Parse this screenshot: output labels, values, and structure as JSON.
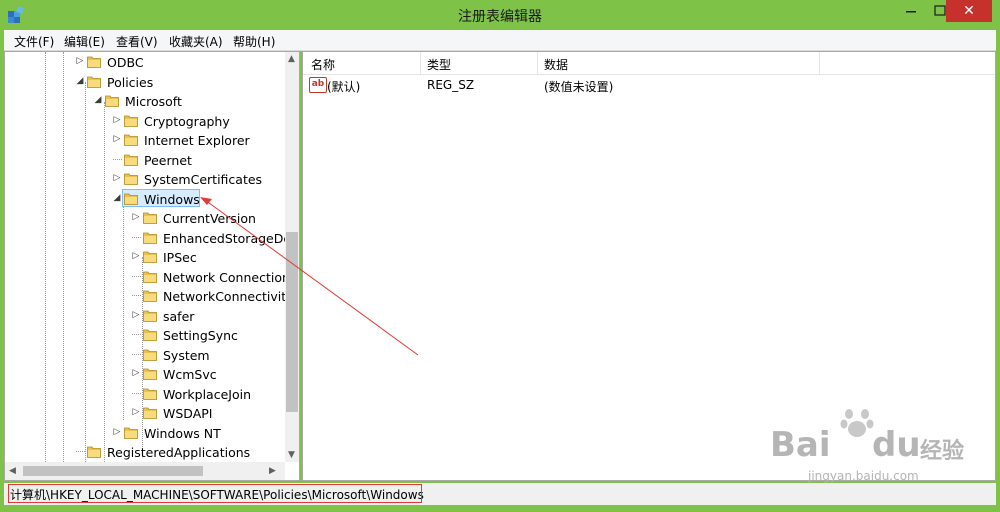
{
  "window": {
    "title": "注册表编辑器",
    "close_glyph": "✕",
    "icon": "regedit-icon",
    "accent": "#7ec347",
    "close_color": "#c6312c"
  },
  "menu": {
    "items": [
      "文件(F)",
      "编辑(E)",
      "查看(V)",
      "收藏夹(A)",
      "帮助(H)"
    ]
  },
  "tree": {
    "items": [
      {
        "label": "ODBC",
        "level": 2,
        "expander": "▷"
      },
      {
        "label": "Policies",
        "level": 2,
        "expander": "◢"
      },
      {
        "label": "Microsoft",
        "level": 3,
        "expander": "◢"
      },
      {
        "label": "Cryptography",
        "level": 4,
        "expander": "▷"
      },
      {
        "label": "Internet Explorer",
        "level": 4,
        "expander": "▷"
      },
      {
        "label": "Peernet",
        "level": 4,
        "expander": ""
      },
      {
        "label": "SystemCertificates",
        "level": 4,
        "expander": "▷"
      },
      {
        "label": "Windows",
        "level": 4,
        "expander": "◢",
        "selected": true
      },
      {
        "label": "CurrentVersion",
        "level": 5,
        "expander": "▷"
      },
      {
        "label": "EnhancedStorageDev",
        "level": 5,
        "expander": ""
      },
      {
        "label": "IPSec",
        "level": 5,
        "expander": "▷"
      },
      {
        "label": "Network Connection",
        "level": 5,
        "expander": ""
      },
      {
        "label": "NetworkConnectivity",
        "level": 5,
        "expander": ""
      },
      {
        "label": "safer",
        "level": 5,
        "expander": "▷"
      },
      {
        "label": "SettingSync",
        "level": 5,
        "expander": ""
      },
      {
        "label": "System",
        "level": 5,
        "expander": ""
      },
      {
        "label": "WcmSvc",
        "level": 5,
        "expander": "▷"
      },
      {
        "label": "WorkplaceJoin",
        "level": 5,
        "expander": ""
      },
      {
        "label": "WSDAPI",
        "level": 5,
        "expander": "▷"
      },
      {
        "label": "Windows NT",
        "level": 4,
        "expander": "▷"
      },
      {
        "label": "RegisteredApplications",
        "level": 2,
        "expander": ""
      }
    ],
    "scroll_up_glyph": "▲",
    "scroll_down_glyph": "▼",
    "scroll_left_glyph": "◀",
    "scroll_right_glyph": "▶"
  },
  "list": {
    "columns": [
      "名称",
      "类型",
      "数据"
    ],
    "rows": [
      {
        "icon": "ab",
        "name": "(默认)",
        "type": "REG_SZ",
        "data": "(数值未设置)"
      }
    ]
  },
  "status": {
    "path": "计算机\\HKEY_LOCAL_MACHINE\\SOFTWARE\\Policies\\Microsoft\\Windows",
    "highlight_color": "#e53935"
  },
  "watermark": {
    "brand": "Bai",
    "brand2": "du",
    "cn": "经验",
    "url": "jingyan.baidu.com"
  }
}
